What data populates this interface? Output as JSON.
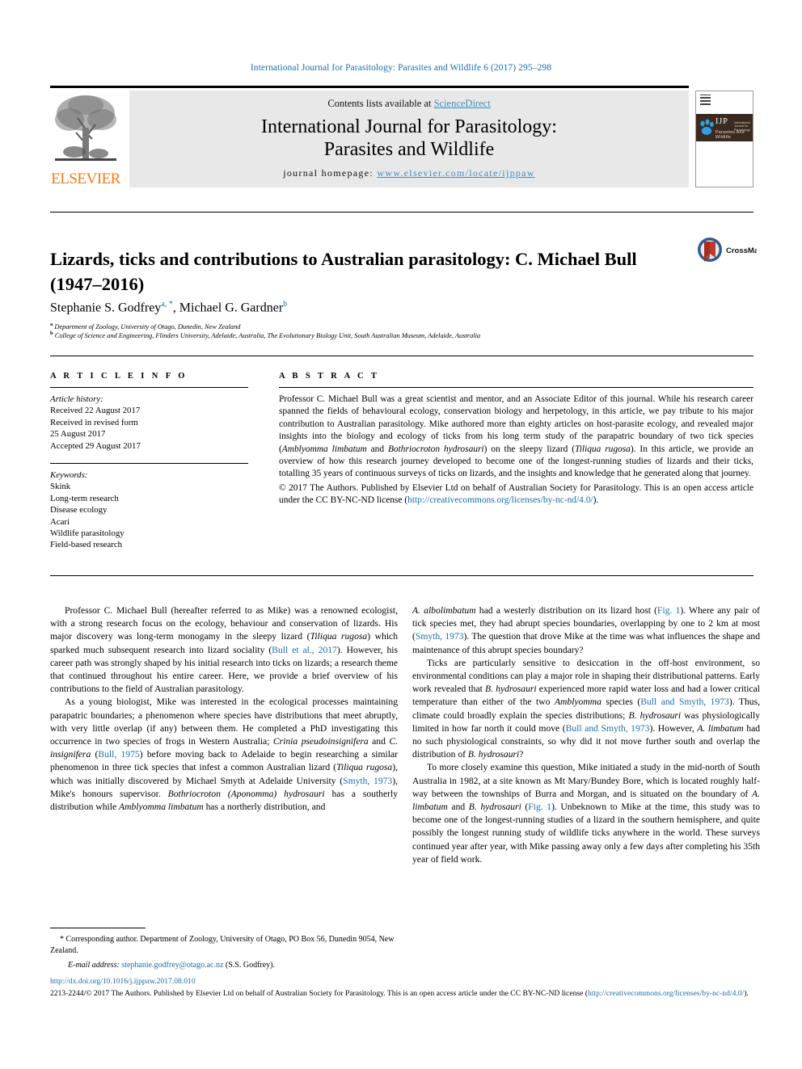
{
  "running_head": "International Journal for Parasitology: Parasites and Wildlife 6 (2017) 295–298",
  "masthead": {
    "publisher": "ELSEVIER",
    "contents_prefix": "Contents lists available at ",
    "contents_link": "ScienceDirect",
    "journal_title_line1": "International Journal for Parasitology:",
    "journal_title_line2": "Parasites and Wildlife",
    "homepage_label": "journal homepage: ",
    "homepage_url": "www.elsevier.com/locate/ijppaw",
    "cover_logo_text": "IJP",
    "cover_logo_sub": "Parasites And Wildlife",
    "cover_logo_sub2": "International Journal for Parasitology"
  },
  "title": "Lizards, ticks and contributions to Australian parasitology: C. Michael Bull (1947–2016)",
  "crossmark_label": "CrossMark",
  "authors": {
    "a1_name": "Stephanie S. Godfrey",
    "a1_marks": "a, *",
    "separator": ", ",
    "a2_name": "Michael G. Gardner",
    "a2_marks": "b"
  },
  "affiliations": {
    "a": "Department of Zoology, University of Otago, Dunedin, New Zealand",
    "a_mark": "a",
    "b": "College of Science and Engineering, Flinders University, Adelaide, Australia, The Evolutionary Biology Unit, South Australian Museum, Adelaide, Australia",
    "b_mark": "b"
  },
  "article_info": {
    "heading": "A R T I C L E  I N F O",
    "history_label": "Article history:",
    "received": "Received 22 August 2017",
    "revised_label": "Received in revised form",
    "revised_date": "25 August 2017",
    "accepted": "Accepted 29 August 2017",
    "keywords_label": "Keywords:",
    "keywords": [
      "Skink",
      "Long-term research",
      "Disease ecology",
      "Acari",
      "Wildlife parasitology",
      "Field-based research"
    ]
  },
  "abstract": {
    "heading": "A B S T R A C T",
    "p1_part1": "Professor C. Michael Bull was a great scientist and mentor, and an Associate Editor of this journal. While his research career spanned the fields of behavioural ecology, conservation biology and herpetology, in this article, we pay tribute to his major contribution to Australian parasitology. Mike authored more than eighty articles on host-parasite ecology, and revealed major insights into the biology and ecology of ticks from his long term study of the parapatric boundary of two tick species (",
    "sp1": "Amblyomma limbatum",
    "p1_part2": " and ",
    "sp2": "Bothriocroton hydrosauri",
    "p1_part3": ") on the sleepy lizard (",
    "sp3": "Tiliqua rugosa",
    "p1_part4": "). In this article, we provide an overview of how this research journey developed to become one of the longest-running studies of lizards and their ticks, totalling 35 years of continuous surveys of ticks on lizards, and the insights and knowledge that he generated along that journey.",
    "copyright_part1": "© 2017 The Authors. Published by Elsevier Ltd on behalf of Australian Society for Parasitology. This is an open access article under the CC BY-NC-ND license (",
    "copyright_link": "http://creativecommons.org/licenses/by-nc-nd/4.0/",
    "copyright_part2": ")."
  },
  "body": {
    "left": {
      "p1_a": "Professor C. Michael Bull (hereafter referred to as Mike) was a renowned ecologist, with a strong research focus on the ecology, behaviour and conservation of lizards. His major discovery was long-term monogamy in the sleepy lizard (",
      "p1_sp": "Tiliqua rugosa",
      "p1_b": ") which sparked much subsequent research into lizard sociality (",
      "p1_cite": "Bull et al., 2017",
      "p1_c": "). However, his career path was strongly shaped by his initial research into ticks on lizards; a research theme that continued throughout his entire career. Here, we provide a brief overview of his contributions to the field of Australian parasitology.",
      "p2_a": "As a young biologist, Mike was interested in the ecological processes maintaining parapatric boundaries; a phenomenon where species have distributions that meet abruptly, with very little overlap (if any) between them. He completed a PhD investigating this occurrence in two species of frogs in Western Australia; ",
      "p2_sp1": "Crinia pseudoinsignifera",
      "p2_b": " and ",
      "p2_sp2": "C. insignifera",
      "p2_c": " (",
      "p2_cite1": "Bull, 1975",
      "p2_d": ") before moving back to Adelaide to begin researching a similar phenomenon in three tick species that infest a common Australian lizard (",
      "p2_sp3": "Tiliqua rugosa",
      "p2_e": "), which was initially discovered by Michael Smyth at Adelaide University (",
      "p2_cite2": "Smyth, 1973",
      "p2_f": "), Mike's honours supervisor. ",
      "p2_sp4": "Bothriocroton (Aponomma) hydrosauri",
      "p2_g": " has a southerly distribution while ",
      "p2_sp5": "Amblyomma limbatum",
      "p2_h": " has a northerly distribution, and"
    },
    "right": {
      "p3_sp1": "A. albolimbatum",
      "p3_a": " had a westerly distribution on its lizard host (",
      "p3_cite1": "Fig. 1",
      "p3_b": "). Where any pair of tick species met, they had abrupt species boundaries, overlapping by one to 2 km at most (",
      "p3_cite2": "Smyth, 1973",
      "p3_c": "). The question that drove Mike at the time was what influences the shape and maintenance of this abrupt species boundary?",
      "p4_a": "Ticks are particularly sensitive to desiccation in the off-host environment, so environmental conditions can play a major role in shaping their distributional patterns. Early work revealed that ",
      "p4_sp1": "B. hydrosauri",
      "p4_b": " experienced more rapid water loss and had a lower critical temperature than either of the two ",
      "p4_sp2": "Amblyomma",
      "p4_c": " species (",
      "p4_cite1": "Bull and Smyth, 1973",
      "p4_d": "). Thus, climate could broadly explain the species distributions; ",
      "p4_sp3": "B. hydrosauri",
      "p4_e": " was physiologically limited in how far north it could move (",
      "p4_cite2": "Bull and Smyth, 1973",
      "p4_f": "). However, ",
      "p4_sp4": "A. limbatum",
      "p4_g": " had no such physiological constraints, so why did it not move further south and overlap the distribution of ",
      "p4_sp5": "B. hydrosauri",
      "p4_h": "?",
      "p5_a": "To more closely examine this question, Mike initiated a study in the mid-north of South Australia in 1982, at a site known as Mt Mary/Bundey Bore, which is located roughly half-way between the townships of Burra and Morgan, and is situated on the boundary of ",
      "p5_sp1": "A. limbatum",
      "p5_b": " and ",
      "p5_sp2": "B. hydrosauri",
      "p5_c": " (",
      "p5_cite1": "Fig. 1",
      "p5_d": "). Unbeknown to Mike at the time, this study was to become one of the longest-running studies of a lizard in the southern hemisphere, and quite possibly the longest running study of wildlife ticks anywhere in the world. These surveys continued year after year, with Mike passing away only a few days after completing his 35th year of field work."
    }
  },
  "footnote": {
    "star": "*",
    "corresponding": " Corresponding author. Department of Zoology, University of Otago, PO Box 56, Dunedin 9054, New Zealand.",
    "email_label": "E-mail address:",
    "email": "stephanie.godfrey@otago.ac.nz",
    "email_suffix": " (S.S. Godfrey)."
  },
  "footer": {
    "doi": "http://dx.doi.org/10.1016/j.ijppaw.2017.08.010",
    "issn_part1": "2213-2244/© 2017 The Authors. Published by Elsevier Ltd on behalf of Australian Society for Parasitology. This is an open access article under the CC BY-NC-ND license (",
    "issn_link": "http://creativecommons.org/licenses/by-nc-nd/4.0/",
    "issn_part2": ")."
  },
  "colors": {
    "link": "#1a6fa8",
    "elsevier_orange": "#ef7d1a",
    "science_direct": "#3d8fc4",
    "band_gray": "#e8e8e8"
  }
}
